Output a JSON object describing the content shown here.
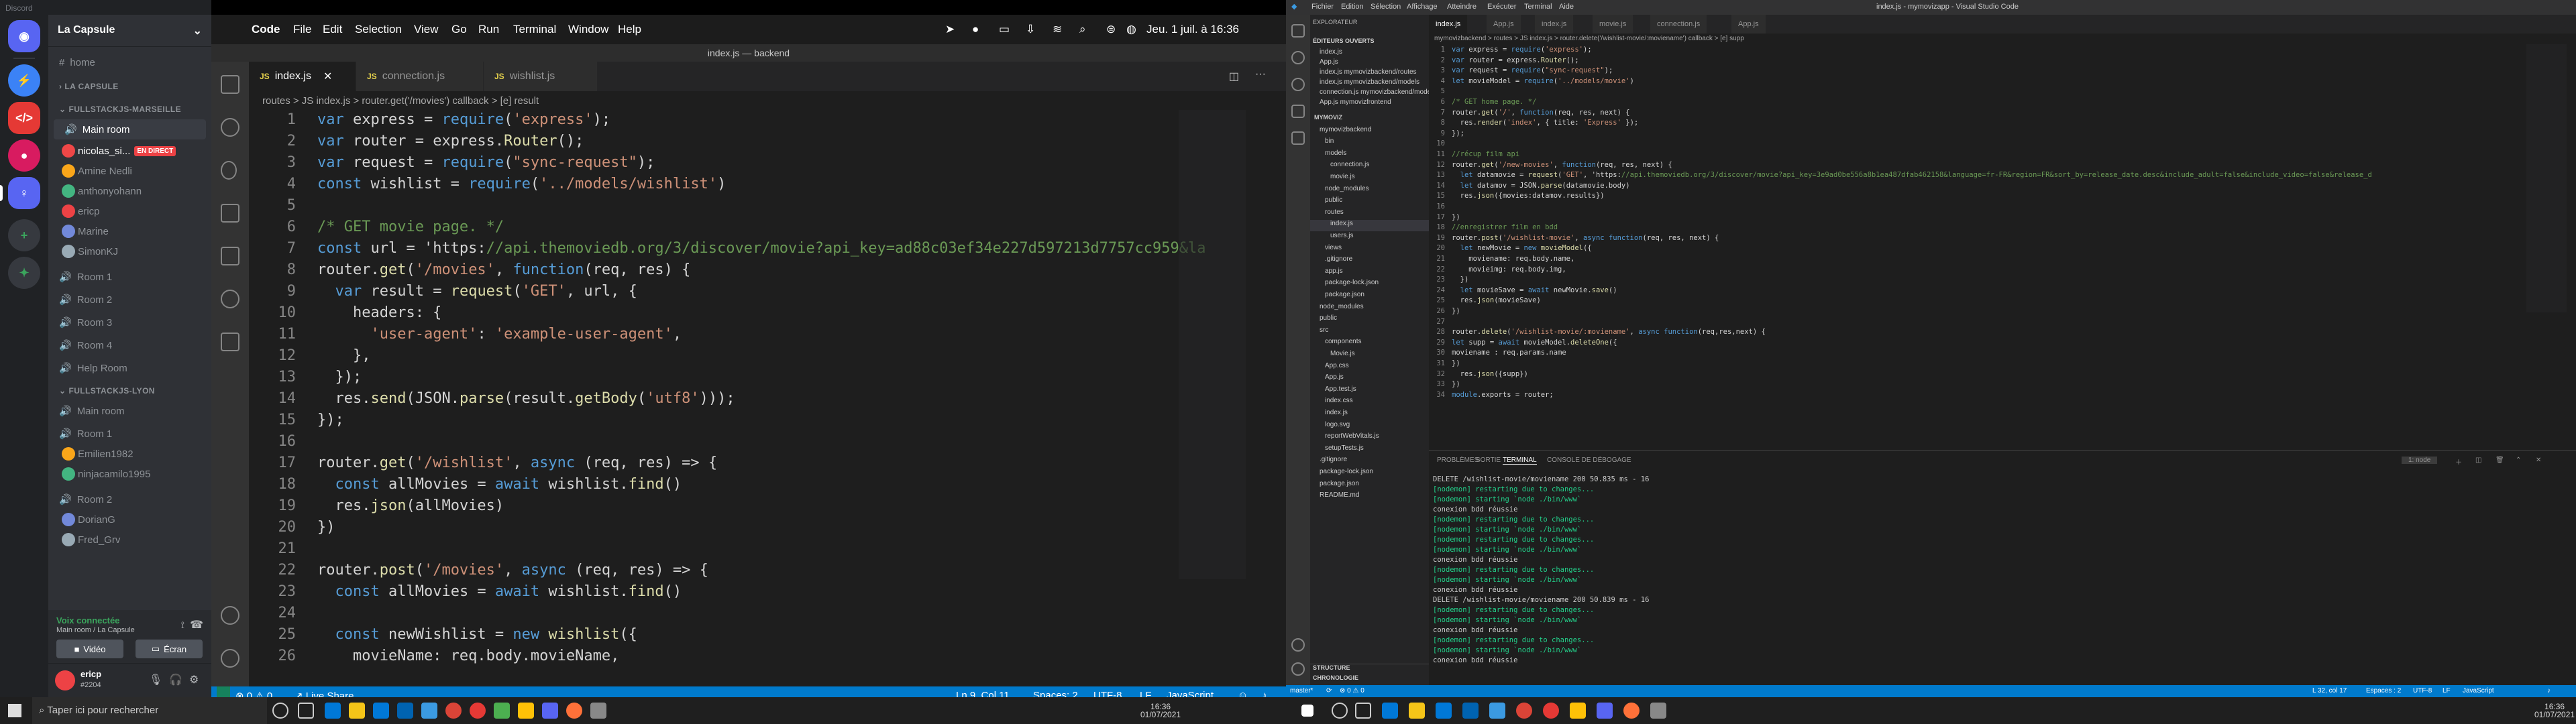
{
  "discord": {
    "window_title": "Discord",
    "guild_name": "La Capsule",
    "home": "home",
    "cat_capsule": "LA CAPSULE",
    "cat_marseille": "FULLSTACKJS-MARSEILLE",
    "main_room": "Main room",
    "users_marseille": [
      "nicolas_si...",
      "Amine Nedli",
      "anthonyohann",
      "ericp",
      "Marine",
      "SimonKJ"
    ],
    "live_badge": "EN DIRECT",
    "rooms": [
      "Room 1",
      "Room 2",
      "Room 3",
      "Room 4",
      "Help Room"
    ],
    "cat_lyon": "FULLSTACKJS-LYON",
    "lyon_main": "Main room",
    "lyon_room1": "Room 1",
    "users_lyon1": [
      "Emilien1982",
      "ninjacamilo1995"
    ],
    "lyon_room2": "Room 2",
    "users_lyon2": [
      "DorianG",
      "Fred_Grv"
    ],
    "voice_status": "Voix connectée",
    "voice_sub": "Main room / La Capsule",
    "btn_video": "Vidéo",
    "btn_screen": "Écran",
    "user_name": "ericp",
    "user_tag": "#2204"
  },
  "mac_menu": {
    "app": "Code",
    "items": [
      "File",
      "Edit",
      "Selection",
      "View",
      "Go",
      "Run",
      "Terminal",
      "Window",
      "Help"
    ],
    "clock": "Jeu. 1 juil. à 16:36"
  },
  "left_editor": {
    "title": "index.js — backend",
    "tabs": [
      "index.js",
      "connection.js",
      "wishlist.js"
    ],
    "breadcrumb": "routes  >  JS index.js  >  router.get('/movies') callback  >  [e] result",
    "lines": [
      {
        "n": "1",
        "code": "var express = require('express');"
      },
      {
        "n": "2",
        "code": "var router = express.Router();"
      },
      {
        "n": "3",
        "code": "var request = require(\"sync-request\");"
      },
      {
        "n": "4",
        "code": "const wishlist = require('../models/wishlist')"
      },
      {
        "n": "5",
        "code": ""
      },
      {
        "n": "6",
        "code": "/* GET movie page. */"
      },
      {
        "n": "7",
        "code": "const url = 'https://api.themoviedb.org/3/discover/movie?api_key=ad88c03ef34e227d597213d7757cc959&la"
      },
      {
        "n": "8",
        "code": "router.get('/movies', function(req, res) {"
      },
      {
        "n": "9",
        "code": "  var result = request('GET', url, {"
      },
      {
        "n": "10",
        "code": "    headers: {"
      },
      {
        "n": "11",
        "code": "      'user-agent': 'example-user-agent',"
      },
      {
        "n": "12",
        "code": "    },"
      },
      {
        "n": "13",
        "code": "  });"
      },
      {
        "n": "14",
        "code": "  res.send(JSON.parse(result.getBody('utf8')));"
      },
      {
        "n": "15",
        "code": "});"
      },
      {
        "n": "16",
        "code": ""
      },
      {
        "n": "17",
        "code": "router.get('/wishlist', async (req, res) => {"
      },
      {
        "n": "18",
        "code": "  const allMovies = await wishlist.find()"
      },
      {
        "n": "19",
        "code": "  res.json(allMovies)"
      },
      {
        "n": "20",
        "code": "})"
      },
      {
        "n": "21",
        "code": ""
      },
      {
        "n": "22",
        "code": "router.post('/movies', async (req, res) => {"
      },
      {
        "n": "23",
        "code": "  const allMovies = await wishlist.find()"
      },
      {
        "n": "24",
        "code": ""
      },
      {
        "n": "25",
        "code": "  const newWishlist = new wishlist({"
      },
      {
        "n": "26",
        "code": "    movieName: req.body.movieName,"
      }
    ],
    "status": {
      "errors": "⊗ 0 ⚠ 0",
      "live_share": "Live Share",
      "position": "Ln 9, Col 11",
      "spaces": "Spaces: 2",
      "encoding": "UTF-8",
      "eol": "LF",
      "lang": "JavaScript"
    }
  },
  "right_editor": {
    "window_title": "index.js - mymovizapp - Visual Studio Code",
    "menu": [
      "Fichier",
      "Edition",
      "Sélection",
      "Affichage",
      "Atteindre",
      "Exécuter",
      "Terminal",
      "Aide"
    ],
    "explorer_title": "EXPLORATEUR",
    "open_editors": "ÉDITEURS OUVERTS",
    "open_files": [
      "index.js",
      "App.js",
      "index.js  mymovizbackend/routes",
      "index.js  mymovizbackend/models",
      "connection.js  mymovizbackend/models",
      "App.js  mymovizfrontend"
    ],
    "tree": [
      "MYMOVIZ",
      "mymovizbackend",
      "bin",
      "models",
      "connection.js",
      "movie.js",
      "node_modules",
      "public",
      "routes",
      "index.js",
      "users.js",
      "views",
      ".gitignore",
      "app.js",
      "package-lock.json",
      "package.json",
      "node_modules",
      "public",
      "src",
      "components",
      "Movie.js",
      "App.css",
      "App.js",
      "App.test.js",
      "index.css",
      "index.js",
      "logo.svg",
      "reportWebVitals.js",
      "setupTests.js",
      ".gitignore",
      "package-lock.json",
      "package.json",
      "README.md"
    ],
    "outline": "STRUCTURE",
    "timeline": "CHRONOLOGIE",
    "tabs": [
      "index.js",
      "App.js",
      "index.js",
      "movie.js",
      "connection.js",
      "App.js"
    ],
    "breadcrumb": "mymovizbackend > routes > JS index.js > router.delete('/wishlist-movie/:moviename') callback > [e] supp",
    "lines": [
      {
        "n": "1",
        "code": "var express = require('express');"
      },
      {
        "n": "2",
        "code": "var router = express.Router();"
      },
      {
        "n": "3",
        "code": "var request = require(\"sync-request\");"
      },
      {
        "n": "4",
        "code": "let movieModel = require('../models/movie')"
      },
      {
        "n": "5",
        "code": ""
      },
      {
        "n": "6",
        "code": "/* GET home page. */"
      },
      {
        "n": "7",
        "code": "router.get('/', function(req, res, next) {"
      },
      {
        "n": "8",
        "code": "  res.render('index', { title: 'Express' });"
      },
      {
        "n": "9",
        "code": "});"
      },
      {
        "n": "10",
        "code": ""
      },
      {
        "n": "11",
        "code": "//récup film api"
      },
      {
        "n": "12",
        "code": "router.get('/new-movies', function(req, res, next) {"
      },
      {
        "n": "13",
        "code": "  let datamovie = request('GET', 'https://api.themoviedb.org/3/discover/movie?api_key=3e9ad0be556a8b1ea487dfab462158&language=fr-FR&region=FR&sort_by=release_date.desc&include_adult=false&include_video=false&release_d"
      },
      {
        "n": "14",
        "code": "  let datamov = JSON.parse(datamovie.body)"
      },
      {
        "n": "15",
        "code": "  res.json({movies:datamov.results})"
      },
      {
        "n": "16",
        "code": ""
      },
      {
        "n": "17",
        "code": "})"
      },
      {
        "n": "18",
        "code": "//enregistrer film en bdd"
      },
      {
        "n": "19",
        "code": "router.post('/wishlist-movie', async function(req, res, next) {"
      },
      {
        "n": "20",
        "code": "  let newMovie = new movieModel({"
      },
      {
        "n": "21",
        "code": "    moviename: req.body.name,"
      },
      {
        "n": "22",
        "code": "    movieimg: req.body.img,"
      },
      {
        "n": "23",
        "code": "  })"
      },
      {
        "n": "24",
        "code": "  let movieSave = await newMovie.save()"
      },
      {
        "n": "25",
        "code": "  res.json(movieSave)"
      },
      {
        "n": "26",
        "code": "})"
      },
      {
        "n": "27",
        "code": ""
      },
      {
        "n": "28",
        "code": "router.delete('/wishlist-movie/:moviename', async function(req,res,next) {"
      },
      {
        "n": "29",
        "code": "let supp = await movieModel.deleteOne({"
      },
      {
        "n": "30",
        "code": "moviename : req.params.name"
      },
      {
        "n": "31",
        "code": "})"
      },
      {
        "n": "32",
        "code": "  res.json({supp})"
      },
      {
        "n": "33",
        "code": "})"
      },
      {
        "n": "34",
        "code": "module.exports = router;"
      }
    ],
    "panel_tabs": [
      "PROBLÈMES",
      "SORTIE",
      "TERMINAL",
      "CONSOLE DE DÉBOGAGE"
    ],
    "terminal_select": "1: node",
    "terminal": [
      "DELETE /wishlist-movie/moviename 200 50.835 ms - 16",
      "[nodemon] restarting due to changes...",
      "[nodemon] starting `node ./bin/www`",
      "conexion bdd réussie",
      "[nodemon] restarting due to changes...",
      "[nodemon] starting `node ./bin/www`",
      "[nodemon] restarting due to changes...",
      "[nodemon] starting `node ./bin/www`",
      "conexion bdd réussie",
      "[nodemon] restarting due to changes...",
      "[nodemon] starting `node ./bin/www`",
      "conexion bdd réussie",
      "DELETE /wishlist-movie/moviename 200 50.839 ms - 16",
      "[nodemon] restarting due to changes...",
      "[nodemon] starting `node ./bin/www`",
      "conexion bdd réussie",
      "[nodemon] restarting due to changes...",
      "[nodemon] starting `node ./bin/www`",
      "conexion bdd réussie"
    ],
    "status": {
      "branch": "master*",
      "errors": "⊗ 0 ⚠ 0",
      "position": "L 32, col 17",
      "spaces": "Espaces : 2",
      "encoding": "UTF-8",
      "eol": "LF",
      "lang": "JavaScript"
    }
  },
  "taskbar": {
    "search": "Taper ici pour rechercher",
    "time": "16:36",
    "date": "01/07/2021",
    "time2": "16:36",
    "date2": "01/07/2021"
  }
}
